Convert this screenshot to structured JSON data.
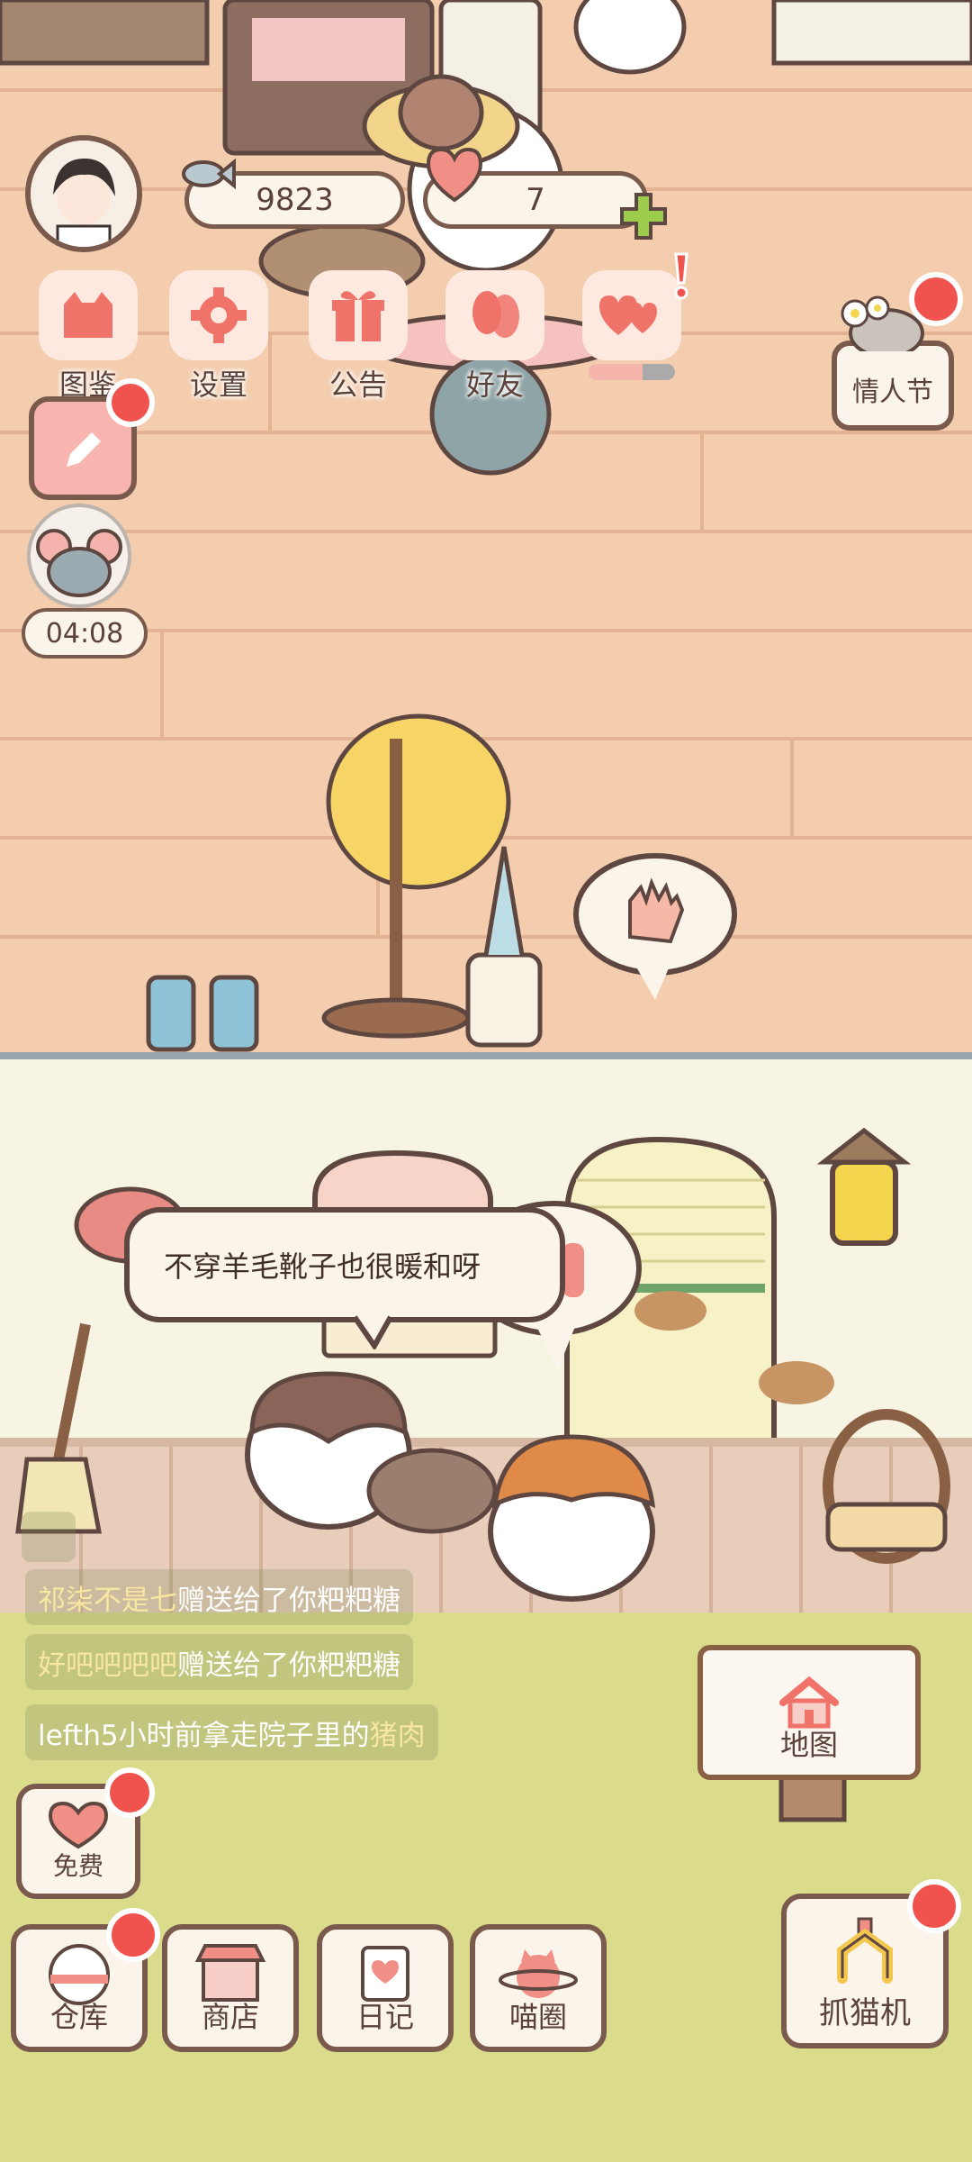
{
  "currency": {
    "fish": "9823",
    "hearts": "7"
  },
  "menu": {
    "handbook": "图鉴",
    "settings": "设置",
    "notice": "公告",
    "friends": "好友"
  },
  "event": {
    "label": "情人节"
  },
  "timer": "04:08",
  "speech": "不穿羊毛靴子也很暖和呀",
  "chat": [
    {
      "name": "祁柒不是七",
      "text": "赠送给了你粑粑糖"
    },
    {
      "name": "好吧吧吧吧",
      "text": "赠送给了你粑粑糖"
    },
    {
      "prefix": "lefth5小时前拿走院子里的",
      "item": "猪肉"
    }
  ],
  "buttons": {
    "map": "地图",
    "free": "免费",
    "warehouse": "仓库",
    "shop": "商店",
    "diary": "日记",
    "meow_circle": "喵圈",
    "claw_machine": "抓猫机"
  },
  "colors": {
    "outline": "#7a5a4c",
    "accent": "#f0736a",
    "badge": "#f0534e",
    "plus": "#9ccc4b"
  }
}
